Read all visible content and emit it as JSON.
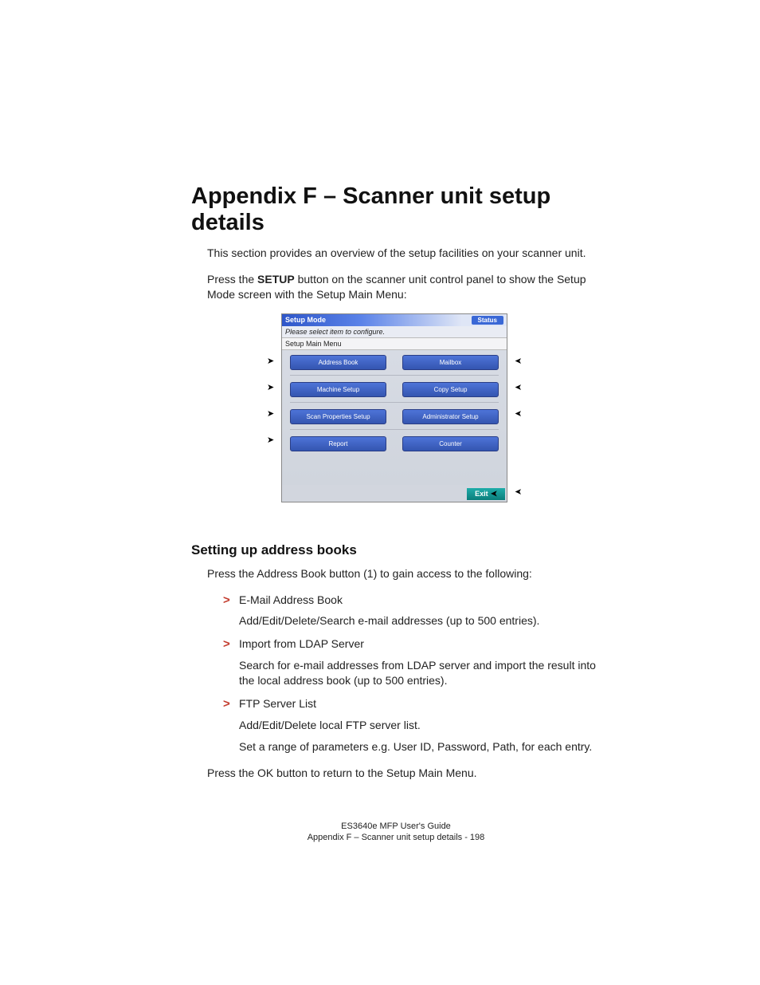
{
  "heading": "Appendix F – Scanner unit setup details",
  "intro1": "This section provides an overview of the setup facilities on your scanner unit.",
  "intro2_a": "Press the ",
  "intro2_b": "SETUP",
  "intro2_c": " button on the scanner unit control panel to show the Setup Mode screen with the Setup Main Menu:",
  "panel": {
    "title": "Setup Mode",
    "status": "Status",
    "instruction": "Please select item to configure.",
    "menu_label": "Setup Main Menu",
    "buttons": {
      "r1a": "Address Book",
      "r1b": "Mailbox",
      "r2a": "Machine Setup",
      "r2b": "Copy Setup",
      "r3a": "Scan Properties Setup",
      "r3b": "Administrator Setup",
      "r4a": "Report",
      "r4b": "Counter"
    },
    "exit": "Exit"
  },
  "subhead": "Setting up address books",
  "sub_intro": "Press the Address Book button (1) to gain access to the following:",
  "items": {
    "a_t": "E-Mail Address Book",
    "a_d": "Add/Edit/Delete/Search e-mail addresses (up to 500 entries).",
    "b_t": "Import from LDAP Server",
    "b_d": "Search for e-mail addresses from LDAP server and import the result into the local address book (up to 500 entries).",
    "c_t": "FTP Server List",
    "c_d1": "Add/Edit/Delete local FTP server list.",
    "c_d2": "Set a range of parameters e.g. User ID, Password, Path, for each entry."
  },
  "closing": "Press the OK button to return to the Setup Main Menu.",
  "footer1": "ES3640e MFP User's Guide",
  "footer2": "Appendix F – Scanner unit setup details - 198"
}
